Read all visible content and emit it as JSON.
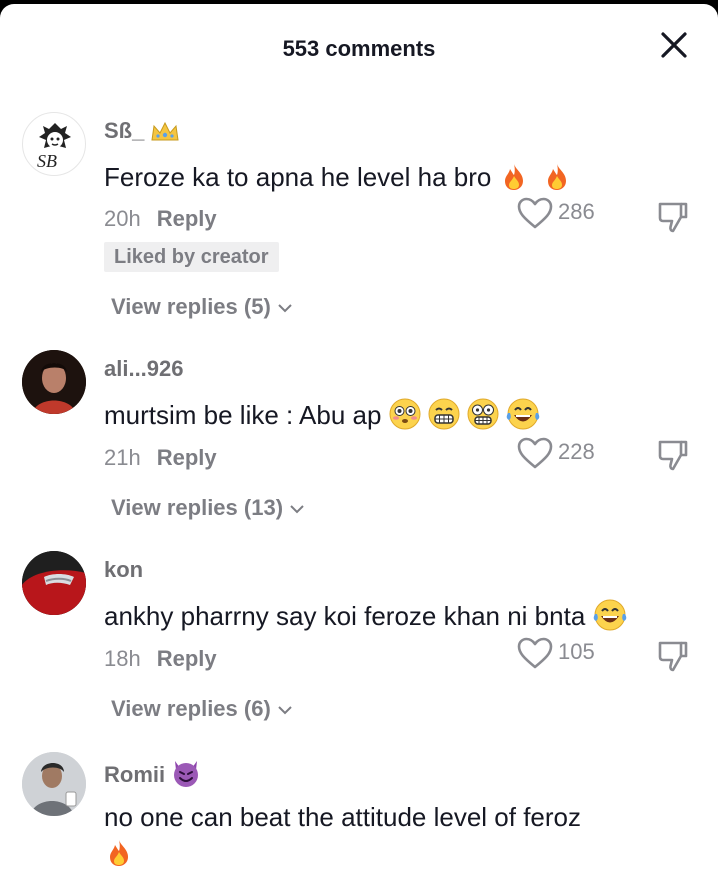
{
  "header": {
    "title": "553 comments"
  },
  "comments": [
    {
      "username": "Sß_",
      "text": "Feroze ka to apna he level ha bro",
      "time": "20h",
      "reply_label": "Reply",
      "likes": "286",
      "badge": "Liked by creator",
      "view_replies": "View replies (5)"
    },
    {
      "username": "ali...926",
      "text": "murtsim be like : Abu ap",
      "time": "21h",
      "reply_label": "Reply",
      "likes": "228",
      "view_replies": "View replies (13)"
    },
    {
      "username": "kon",
      "text": "ankhy pharrny say koi feroze khan ni bnta",
      "time": "18h",
      "reply_label": "Reply",
      "likes": "105",
      "view_replies": "View replies (6)"
    },
    {
      "username": "Romii",
      "text": "no one can beat the attitude level of feroz"
    }
  ],
  "avatar_logo_text": "SB"
}
